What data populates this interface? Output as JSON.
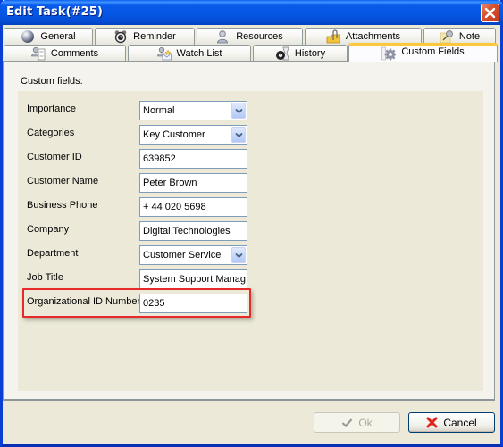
{
  "window": {
    "title": "Edit Task(#25)",
    "close_icon": "close-x-icon"
  },
  "tabs": {
    "row1": [
      {
        "label": "General",
        "icon": "sphere-icon"
      },
      {
        "label": "Reminder",
        "icon": "alarm-clock-icon"
      },
      {
        "label": "Resources",
        "icon": "person-icon"
      },
      {
        "label": "Attachments",
        "icon": "paperclip-folder-icon"
      },
      {
        "label": "Note",
        "icon": "pushpin-icon"
      }
    ],
    "row2": [
      {
        "label": "Comments",
        "icon": "comments-icon"
      },
      {
        "label": "Watch List",
        "icon": "watch-list-icon"
      },
      {
        "label": "History",
        "icon": "history-icon"
      },
      {
        "label": "Custom Fields",
        "icon": "custom-fields-gear-icon",
        "selected": true
      }
    ]
  },
  "custom_fields": {
    "section_label": "Custom fields:",
    "fields": [
      {
        "label": "Importance",
        "type": "select",
        "value": "Normal"
      },
      {
        "label": "Categories",
        "type": "select",
        "value": "Key Customer"
      },
      {
        "label": "Customer ID",
        "type": "text",
        "value": "639852"
      },
      {
        "label": "Customer Name",
        "type": "text",
        "value": "Peter Brown"
      },
      {
        "label": "Business Phone",
        "type": "text",
        "value": "+ 44 020 5698"
      },
      {
        "label": "Company",
        "type": "text",
        "value": "Digital Technologies"
      },
      {
        "label": "Department",
        "type": "select",
        "value": "Customer Service"
      },
      {
        "label": "Job Title",
        "type": "text",
        "value": "System Support Manag"
      },
      {
        "label": "Organizational ID Number",
        "type": "text",
        "value": "0235",
        "highlighted": true
      }
    ]
  },
  "buttons": {
    "ok": {
      "label": "Ok",
      "enabled": false,
      "icon": "checkmark-icon"
    },
    "cancel": {
      "label": "Cancel",
      "enabled": true,
      "icon": "red-x-icon"
    }
  },
  "colors": {
    "titlebar": "#0A5AEB",
    "selected_tab_accent": "#FFC83C",
    "highlight": "#E62A2A",
    "dialog_bg": "#ECE9D8"
  }
}
